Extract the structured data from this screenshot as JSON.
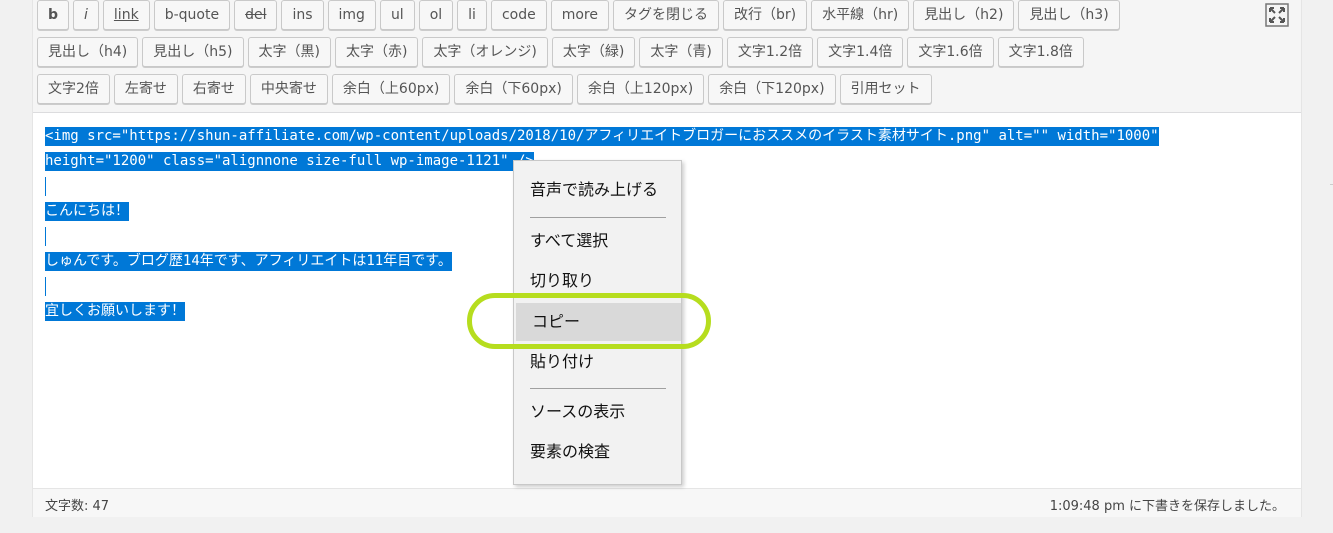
{
  "toolbar": {
    "row1": [
      "b",
      "i",
      "link",
      "b-quote",
      "del",
      "ins",
      "img",
      "ul",
      "ol",
      "li",
      "code",
      "more",
      "タグを閉じる",
      "改行（br)",
      "水平線（hr)",
      "見出し（h2)",
      "見出し（h3)"
    ],
    "row2": [
      "見出し（h4)",
      "見出し（h5)",
      "太字（黒)",
      "太字（赤)",
      "太字（オレンジ)",
      "太字（緑)",
      "太字（青)",
      "文字1.2倍",
      "文字1.4倍",
      "文字1.6倍",
      "文字1.8倍"
    ],
    "row3": [
      "文字2倍",
      "左寄せ",
      "右寄せ",
      "中央寄せ",
      "余白（上60px)",
      "余白（下60px)",
      "余白（上120px)",
      "余白（下120px)",
      "引用セット"
    ],
    "fullscreen_icon": "expand-icon"
  },
  "content": {
    "line1": "<img src=\"https://shun-affiliate.com/wp-content/uploads/2018/10/アフィリエイトブロガーにおススメのイラスト素材サイト.png\" alt=\"\" width=\"1000\"",
    "line2": "height=\"1200\" class=\"alignnone size-full wp-image-1121\" />",
    "line3": "こんにちは！",
    "line4": "しゅんです。ブログ歴14年です、アフィリエイトは11年目です。",
    "line5": "宜しくお願いします！"
  },
  "context_menu": {
    "items": [
      "音声で読み上げる",
      "すべて選択",
      "切り取り",
      "コピー",
      "貼り付け",
      "ソースの表示",
      "要素の検査"
    ],
    "highlighted": "コピー"
  },
  "status": {
    "word_count": "文字数: 47",
    "autosave": "1:09:48 pm に下書きを保存しました。"
  },
  "colors": {
    "selection": "#0078d7",
    "highlight_ring": "#b6dd1e"
  }
}
